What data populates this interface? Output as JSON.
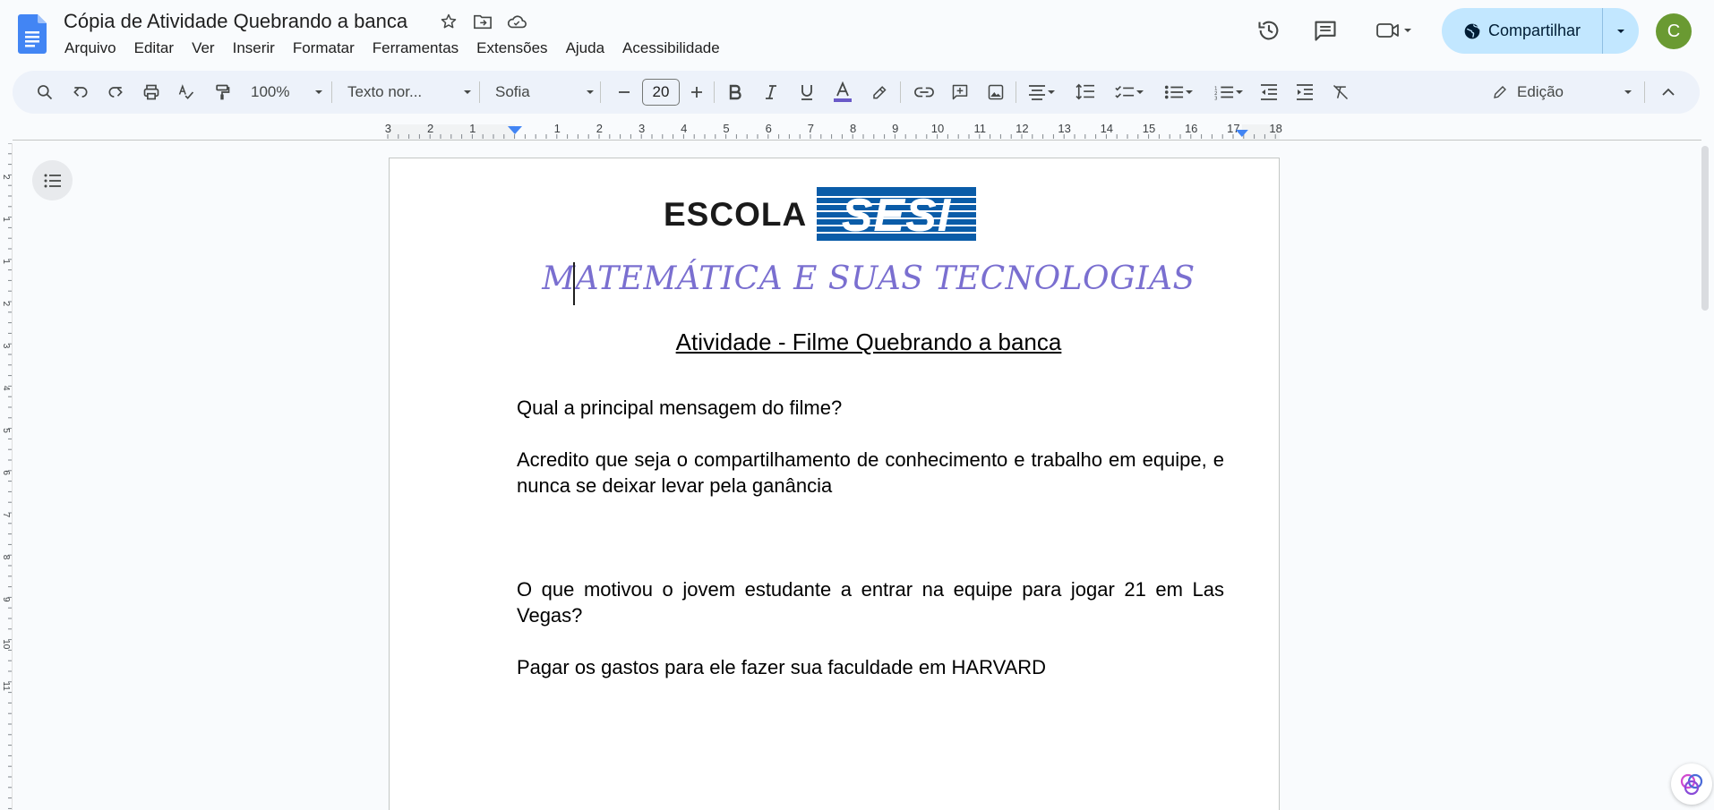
{
  "app": {
    "name": "Google Docs"
  },
  "document": {
    "title": "Cópia de Atividade Quebrando a banca"
  },
  "menu": [
    "Arquivo",
    "Editar",
    "Ver",
    "Inserir",
    "Formatar",
    "Ferramentas",
    "Extensões",
    "Ajuda",
    "Acessibilidade"
  ],
  "share": {
    "label": "Compartilhar"
  },
  "user": {
    "initial": "C",
    "avatar_color": "#6a9a32"
  },
  "toolbar": {
    "zoom": "100%",
    "style": "Texto nor...",
    "font": "Sofia",
    "font_size": "20",
    "mode": "Edição",
    "text_color_bar": "#6a5ac8"
  },
  "ruler": {
    "left_numbers": [
      "3",
      "2",
      "1"
    ],
    "right_numbers": [
      "1",
      "2",
      "3",
      "4",
      "5",
      "6",
      "7",
      "8",
      "9",
      "10",
      "11",
      "12",
      "13",
      "14",
      "15",
      "16",
      "17",
      "18"
    ],
    "vertical_numbers": [
      "2",
      "1",
      "1",
      "2",
      "3",
      "4",
      "5",
      "6",
      "7",
      "8",
      "9",
      "10",
      "11"
    ]
  },
  "page": {
    "logo_word": "ESCOLA",
    "logo_brand": "SESI",
    "subject": "MATEMÁTICA E SUAS TECNOLOGIAS",
    "activity_title": "Atividade - Filme Quebrando a banca",
    "q1": "Qual a principal mensagem do filme?",
    "a1": "Acredito que seja o compartilhamento de conhecimento e trabalho em equipe, e nunca se deixar levar pela ganância",
    "q2": "O que motivou o jovem estudante a entrar na equipe para jogar 21 em Las Vegas?",
    "a2": "Pagar os gastos para ele fazer sua faculdade em HARVARD"
  },
  "colors": {
    "docs_blue": "#4285f4",
    "share_bg": "#c2e7ff",
    "toolbar_bg": "#edf2fa",
    "subject_color": "#7a6fd0",
    "sesi_blue": "#0a5ca8"
  }
}
